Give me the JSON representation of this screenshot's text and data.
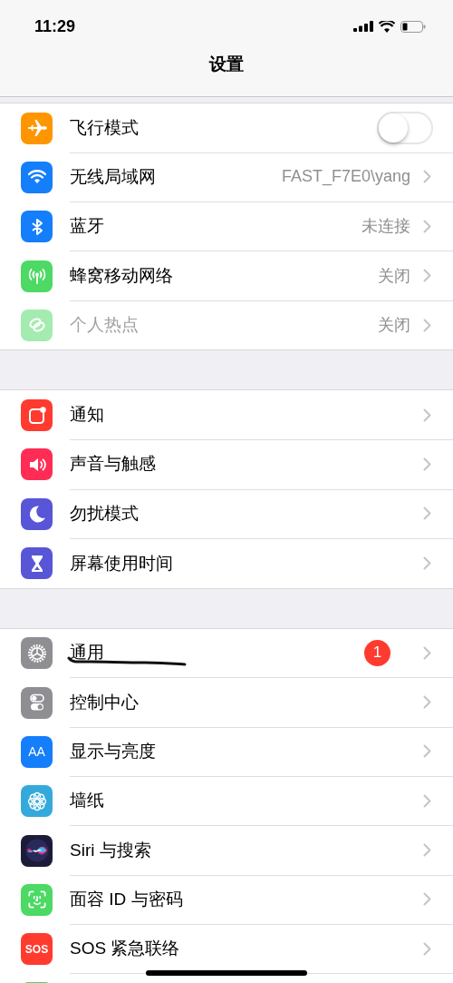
{
  "status_bar": {
    "time": "11:29"
  },
  "nav": {
    "title": "设置"
  },
  "groups": [
    {
      "items": [
        {
          "kind": "toggle",
          "label": "飞行模式",
          "on": false,
          "disabled": false
        },
        {
          "kind": "link",
          "label": "无线局域网",
          "value": "FAST_F7E0\\yang",
          "disabled": false
        },
        {
          "kind": "link",
          "label": "蓝牙",
          "value": "未连接",
          "disabled": false
        },
        {
          "kind": "link",
          "label": "蜂窝移动网络",
          "value": "关闭",
          "disabled": false
        },
        {
          "kind": "link",
          "label": "个人热点",
          "value": "关闭",
          "disabled": true
        }
      ]
    },
    {
      "items": [
        {
          "kind": "link",
          "label": "通知",
          "disabled": false
        },
        {
          "kind": "link",
          "label": "声音与触感",
          "disabled": false
        },
        {
          "kind": "link",
          "label": "勿扰模式",
          "disabled": false
        },
        {
          "kind": "link",
          "label": "屏幕使用时间",
          "disabled": false
        }
      ]
    },
    {
      "items": [
        {
          "kind": "link",
          "label": "通用",
          "badge": "1",
          "scribble": true,
          "disabled": false
        },
        {
          "kind": "link",
          "label": "控制中心",
          "disabled": false
        },
        {
          "kind": "link",
          "icon_text": "AA",
          "label": "显示与亮度",
          "disabled": false
        },
        {
          "kind": "link",
          "label": "墙纸",
          "disabled": false
        },
        {
          "kind": "link",
          "label": "Siri 与搜索",
          "disabled": false
        },
        {
          "kind": "link",
          "label": "面容 ID 与密码",
          "disabled": false
        },
        {
          "kind": "link",
          "icon_text": "SOS",
          "label": "SOS 紧急联络",
          "disabled": false
        },
        {
          "kind": "partial"
        }
      ]
    }
  ]
}
